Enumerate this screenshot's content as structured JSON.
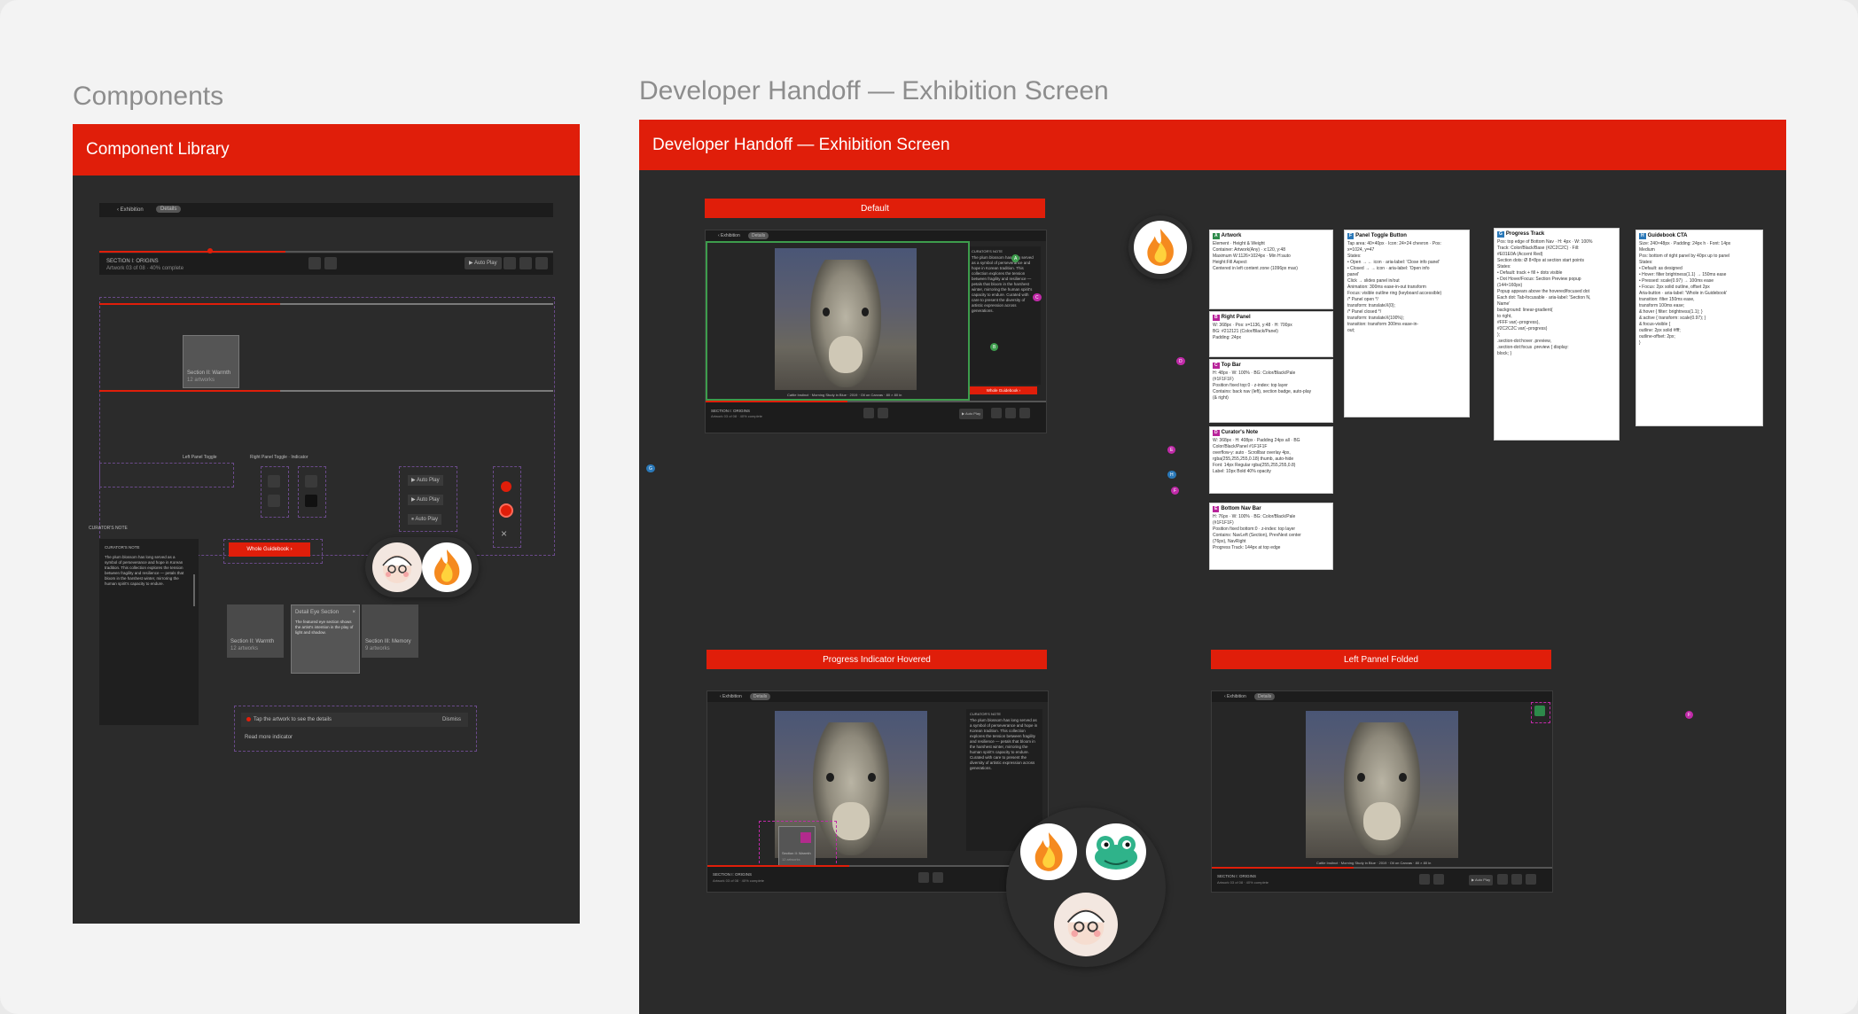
{
  "frames": {
    "components_label": "Components",
    "handoff_label": "Developer Handoff — Exhibition Screen"
  },
  "component_library": {
    "title": "Component Library",
    "back_label": "‹ Exhibition",
    "chip": "Details",
    "section_title": "SECTION I: ORIGINS",
    "section_sub": "Artwork 03 of 08 · 40% complete",
    "auto_play": "▶ Auto Play",
    "card_label": "Section II: Warmth",
    "card_sub": "12 artworks",
    "toggle_label": "Left Panel Toggle",
    "toggle_label2": "Right Panel Toggle · Indicator",
    "cta_label": "Whole Guidebook ›",
    "curators_note": "CURATOR'S NOTE",
    "note_text": "The plum blossom has long served as a symbol of perseverance and hope in Korean tradition. This collection explores the tension between fragility and resilience — petals that bloom in the harshest winter, mirroring the human spirit's capacity to endure.",
    "tooltip_title": "Detail Eye Section",
    "tooltip_text": "The featured eye section shows the artist's intention in the play of light and shadow.",
    "card2_label": "Section III: Memory",
    "card2_sub": "9 artworks",
    "autoplay_1": "▶ Auto Play",
    "autoplay_2": "▶ Auto Play",
    "autoplay_3": "⏸ Auto Play",
    "toast_text": "Tap the artwork to see the details",
    "toast_action": "Dismiss",
    "toast_sub": "Read more indicator"
  },
  "handoff": {
    "title": "Developer Handoff — Exhibition Screen",
    "default_tab": "Default",
    "hovered_tab": "Progress Indicator Hovered",
    "folded_tab": "Left Pannel Folded",
    "back_label": "‹ Exhibition",
    "chip": "Details",
    "section_title": "SECTION I: ORIGINS",
    "section_sub": "Artwork 03 of 08 · 40% complete",
    "auto_play": "▶ Auto Play",
    "cta": "Whole Guidebook ›",
    "caption": "Cattle Instinct · Morning Study in Blue · 2019 · Oil on Canvas · 80 × 80 in",
    "hover_card_title": "Section II: Warmth",
    "hover_card_sub": "12 artworks",
    "curators_note": "CURATOR'S NOTE",
    "note_text": "The plum blossom has long served as a symbol of perseverance and hope in Korean tradition. This collection explores the tension between fragility and resilience — petals that bloom in the harshest winter, mirroring the human spirit's capacity to endure. Curated with care to present the diversity of artistic expression across generations."
  },
  "spec_notes": [
    {
      "tag": "A",
      "title": "Artwork",
      "lines": [
        "Element · Height & Weight",
        "Container: Artwork(Any) · x:120, y:48",
        "Maximum W:1126×1024px · Min H:auto",
        "Height:Fill Aspect",
        "Centered in left content zone (1096px max)"
      ]
    },
    {
      "tag": "B",
      "title": "Right Panel",
      "lines": [
        "W: 368px · Pos: x=1136, y:48 · H: 700px",
        "BG: #212121 (Color/Black/Panel)",
        "Padding: 24px"
      ]
    },
    {
      "tag": "C",
      "title": "Top Bar",
      "lines": [
        "H: 48px · W: 100% · BG: Color/Black/Pale",
        "(#1F1F1F)",
        "Position fixed top:0 · z-index: top layer",
        "Contains: back nav (left), section badge, auto-play",
        "(& right)"
      ]
    },
    {
      "tag": "D",
      "title": "Curator's Note",
      "lines": [
        "W: 368px · H: 408px · Padding 24px all · BG",
        "Color/Black/Panel #1F1F1F",
        "overflow-y: auto · Scrollbar overlay 4px,",
        "rgba(255,255,255,0.18) thumb, auto-hide",
        "Font: 14px Regular rgba(255,255,255,0.8)",
        "Label: 10px Bold 40% opacity"
      ]
    },
    {
      "tag": "E",
      "title": "Bottom Nav Bar",
      "lines": [
        "H: 76px · W: 100% · BG: Color/Black/Pale",
        "(#1F1F1F)",
        "Position fixed bottom:0 · z-index: top layer",
        "Contains: NavLeft (Section), PrevNext center",
        "(76px), NavRight",
        "Progress Track: 144px at top edge"
      ]
    },
    {
      "tag": "F",
      "title": "Panel Toggle Button",
      "lines": [
        "Tap area: 40×40px · Icon: 24×24 chevron · Pos:",
        "x=1024, y=47",
        "",
        "States:",
        "• Open → ← icon · aria-label: 'Close info panel'",
        "• Closed → → icon · aria-label: 'Open info",
        "panel'",
        "",
        "Click → slides panel in/out",
        "Animation: 300ms ease-in-out transform",
        "Focus: visible outline ring (keyboard accessible)",
        "",
        "/* Panel open */",
        "transform: translateX(0);",
        "",
        "/* Panel closed */",
        "transform: translateX(100%);",
        "",
        "transition: transform 300ms ease-in-",
        "out;"
      ]
    },
    {
      "tag": "G",
      "title": "Progress Track",
      "lines": [
        "Pos: top edge of Bottom Nav · H: 4px · W: 100%",
        "Track: Color/Black/Base (#2C2C2C) · Fill:",
        "#E01E0A (Accent Red)",
        "Section dots: Ø 8×8px at section start points",
        "",
        "States:",
        "• Default: track + fill + dots visible",
        "• Dot Hover/Focus: Section Preview popup",
        "(144×160px)",
        "  Popup appears above the hovered/focused dot",
        "",
        "Each dot: Tab-focusable · aria-label: 'Section N,",
        "Name'",
        "",
        "background: linear-gradient(",
        "  to right,",
        "  #FFF var(--progress),",
        "  #2C2C2C var(--progress)",
        ");",
        "",
        ".section-dot:hover .preview,",
        ".section-dot:focus .preview { display:",
        "block; }"
      ]
    },
    {
      "tag": "H",
      "title": "Guidebook CTA",
      "lines": [
        "Size: 240×48px · Padding: 24px h · Font: 14px",
        "Medium",
        "Pos: bottom of right panel by 40px up to panel",
        "",
        "States:",
        "• Default: as designed",
        "• Hover: filter brightness(1.1) → 150ms ease",
        "• Pressed: scale(0.97) → 100ms ease",
        "• Focus: 2px solid outline, offset 2px",
        "",
        "Aria-button · aria-label: 'Whole in Guidebook'",
        "",
        "transition: filter 150ms ease,",
        "transform 100ms ease;",
        "",
        "&:hover { filter: brightness(1.1); }",
        "&:active { transform: scale(0.97); }",
        "&:focus-visible {",
        "  outline: 2px solid #fff;",
        "  outline-offset: 2px;",
        "}"
      ]
    }
  ],
  "colors": {
    "accent": "#E01E0A",
    "panel": "#1F1F1F",
    "board": "#2B2B2B",
    "annotation_green": "#3D9C4C",
    "annotation_purple": "#C02AA8"
  },
  "icons": [
    "fire-emoji",
    "avatar-face",
    "frog-face",
    "chevron-left-icon",
    "chevron-right-icon",
    "play-icon",
    "heart-icon",
    "share-icon",
    "fullscreen-icon",
    "close-icon"
  ]
}
